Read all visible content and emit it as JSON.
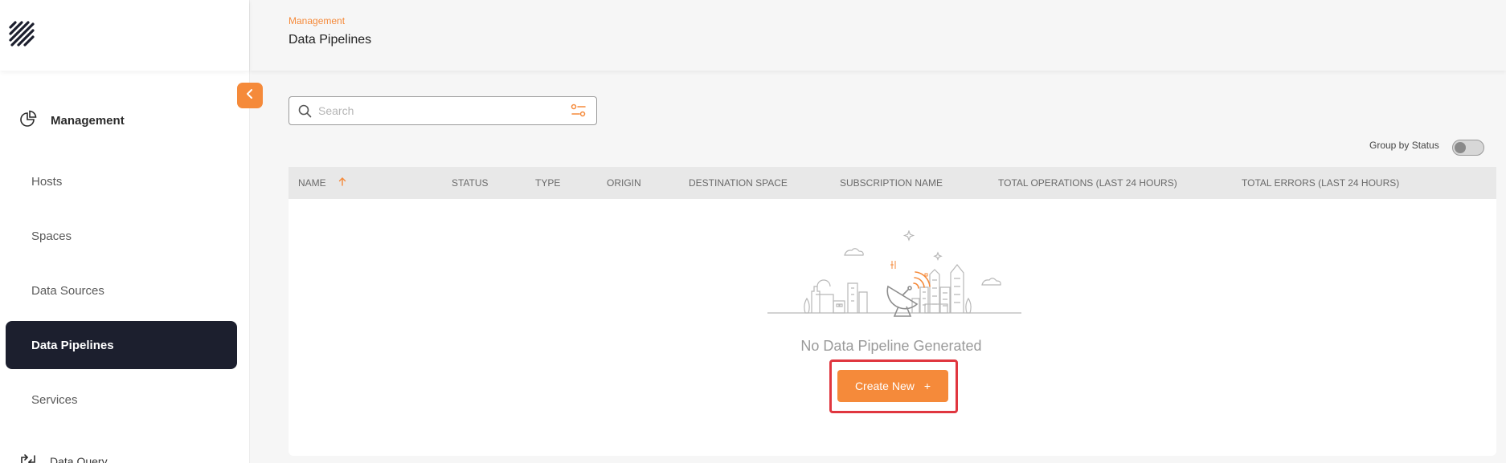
{
  "sidebar": {
    "logo_icon": "hatched-logo-icon",
    "section": {
      "label": "Management",
      "icon": "pie-chart-icon"
    },
    "items": [
      {
        "label": "Hosts"
      },
      {
        "label": "Spaces"
      },
      {
        "label": "Data Sources"
      },
      {
        "label": "Data Pipelines",
        "active": true
      },
      {
        "label": "Services"
      }
    ],
    "bottom": {
      "label": "Data Query",
      "icon": "query-arrows-icon"
    }
  },
  "header": {
    "breadcrumb": "Management",
    "title": "Data Pipelines"
  },
  "search": {
    "placeholder": "Search",
    "value": ""
  },
  "group_toggle": {
    "label": "Group by Status",
    "on": false
  },
  "table": {
    "columns": [
      "NAME",
      "STATUS",
      "TYPE",
      "ORIGIN",
      "DESTINATION SPACE",
      "SUBSCRIPTION NAME",
      "TOTAL OPERATIONS (LAST 24 HOURS)",
      "TOTAL ERRORS (LAST 24 HOURS)"
    ],
    "sort": {
      "column": "NAME",
      "direction": "asc"
    },
    "rows": []
  },
  "empty_state": {
    "message": "No Data Pipeline Generated",
    "button_label": "Create New",
    "button_icon": "+"
  },
  "colors": {
    "accent": "#f58a3a",
    "active_nav_bg": "#1c1f2e",
    "highlight": "#e0363f"
  }
}
